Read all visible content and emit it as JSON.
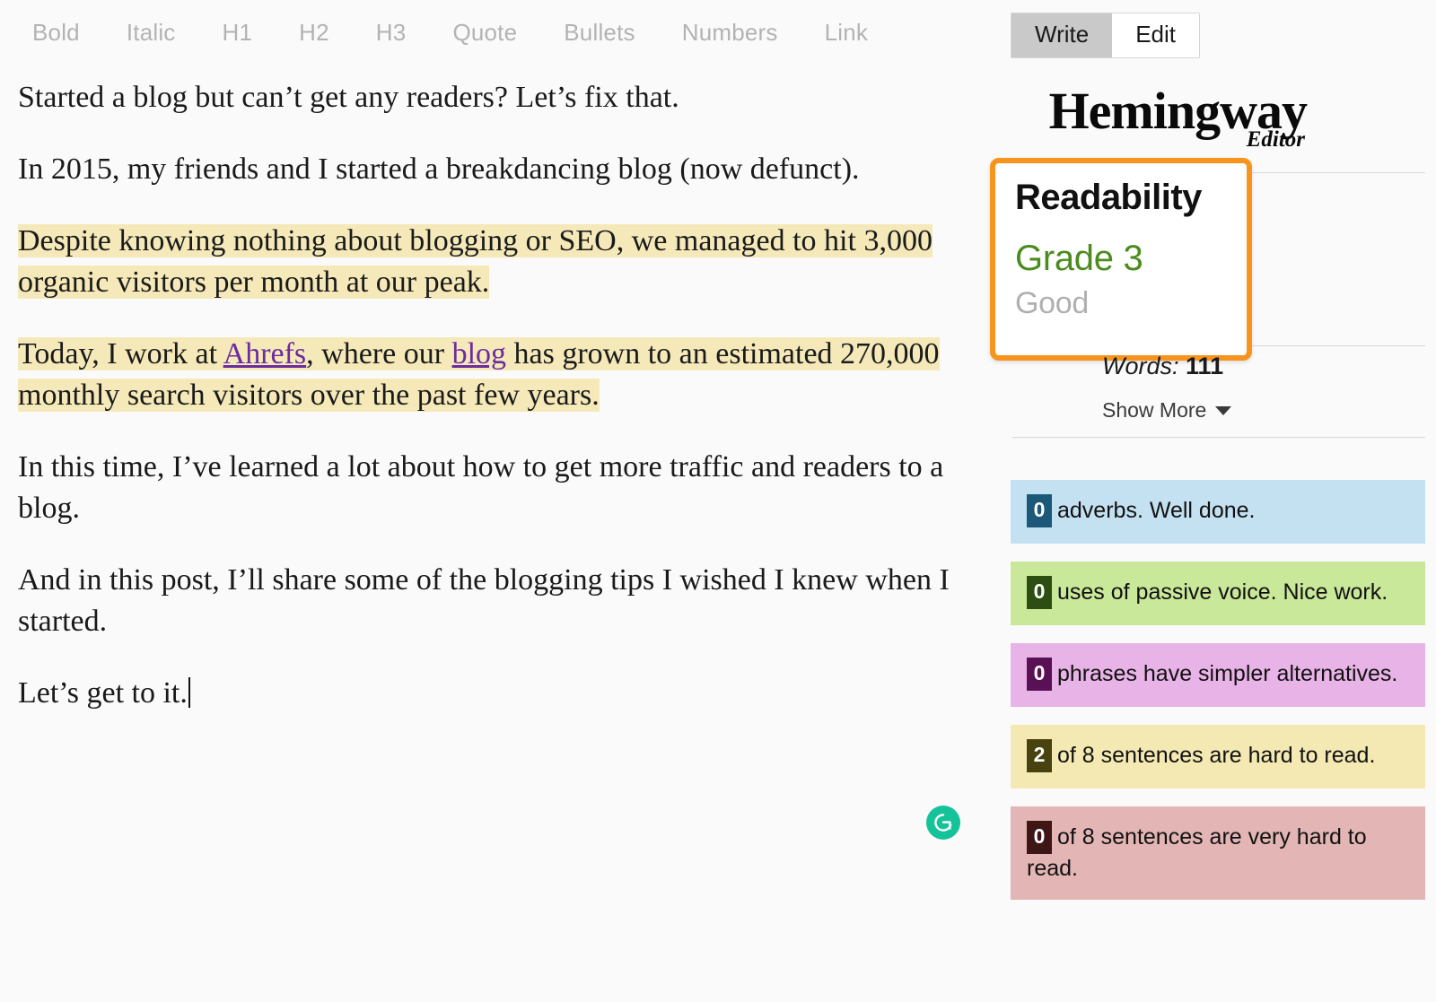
{
  "toolbar": {
    "items": [
      {
        "name": "bold",
        "label": "Bold"
      },
      {
        "name": "italic",
        "label": "Italic"
      },
      {
        "name": "h1",
        "label": "H1"
      },
      {
        "name": "h2",
        "label": "H2"
      },
      {
        "name": "h3",
        "label": "H3"
      },
      {
        "name": "quote",
        "label": "Quote"
      },
      {
        "name": "bullets",
        "label": "Bullets"
      },
      {
        "name": "numbers",
        "label": "Numbers"
      },
      {
        "name": "link",
        "label": "Link"
      }
    ]
  },
  "mode_toggle": {
    "write_label": "Write",
    "edit_label": "Edit",
    "active": "Write"
  },
  "brand": {
    "main": "Hemingway",
    "sub": "Editor"
  },
  "document": {
    "paragraphs": [
      {
        "id": "p1",
        "text": "Started a blog but can’t get any readers? Let’s fix that.",
        "highlight": false
      },
      {
        "id": "p2",
        "text": "In 2015, my friends and I started a breakdancing blog (now defunct).",
        "highlight": false
      },
      {
        "id": "p3",
        "text": "Despite knowing nothing about blogging or SEO, we managed to hit 3,000 organic visitors per month at our peak.",
        "highlight": true
      },
      {
        "id": "p4",
        "highlight": true,
        "segment_1": "Today, I work at ",
        "link_1": "Ahrefs",
        "segment_2": ", where our ",
        "link_2": "blog",
        "segment_3": " has grown to an estimated 270,000 monthly search visitors over the past few years."
      },
      {
        "id": "p5",
        "text": "In this time, I’ve learned a lot about how to get more traffic and readers to a blog.",
        "highlight": false
      },
      {
        "id": "p6",
        "text": "And in this post, I’ll share some of the blogging tips I wished I knew when I started.",
        "highlight": false
      },
      {
        "id": "p7",
        "text": "Let’s get to it.",
        "highlight": false,
        "has_caret": true
      }
    ]
  },
  "grammarly": {
    "icon": "grammarly-g-icon",
    "color": "#15c39a"
  },
  "readability": {
    "title": "Readability",
    "grade": "Grade 3",
    "verdict": "Good",
    "grade_color": "#4b8b1f",
    "verdict_color": "#b0b0b0",
    "highlight_border_color": "#f7941e"
  },
  "word_count": {
    "label": "Words:",
    "value": "111"
  },
  "show_more": {
    "label": "Show More",
    "icon": "chevron-down-icon"
  },
  "stats": [
    {
      "name": "adverbs",
      "count": "0",
      "text": "adverbs. Well done.",
      "bg": "#c4e1f2",
      "badge_bg": "#1c5878"
    },
    {
      "name": "passive-voice",
      "count": "0",
      "text": "uses of passive voice. Nice work.",
      "bg": "#c9e89a",
      "badge_bg": "#2d4e12"
    },
    {
      "name": "simpler-alternatives",
      "count": "0",
      "text": "phrases have simpler alternatives.",
      "bg": "#e8b3e6",
      "badge_bg": "#5a1055"
    },
    {
      "name": "hard-sentences",
      "count": "2",
      "text": "of 8 sentences are hard to read.",
      "bg": "#f4e9b3",
      "badge_bg": "#47420f"
    },
    {
      "name": "very-hard-sentences",
      "count": "0",
      "text": "of 8 sentences are very hard to read.",
      "bg": "#e3b5b5",
      "badge_bg": "#3f1616"
    }
  ]
}
